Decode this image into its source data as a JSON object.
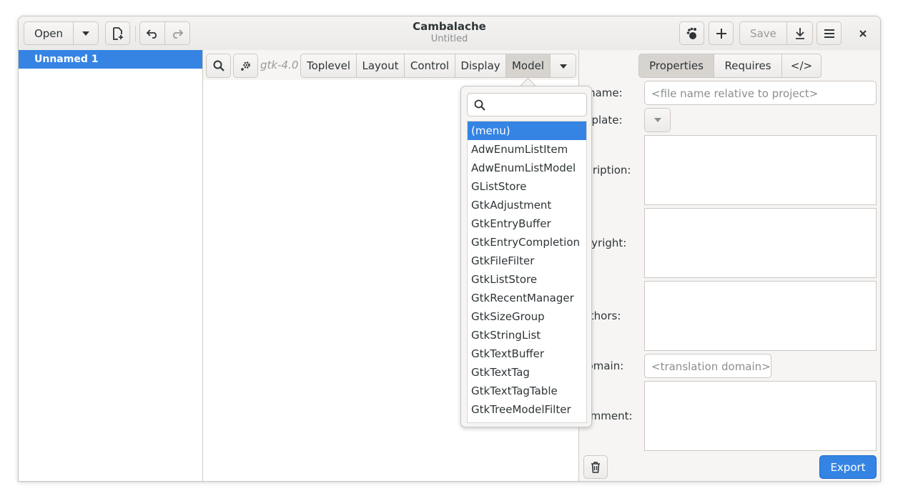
{
  "window": {
    "title": "Cambalache",
    "subtitle": "Untitled"
  },
  "headerbar": {
    "open_label": "Open",
    "save_label": "Save"
  },
  "project_tree": {
    "items": [
      {
        "label": "Unnamed 1",
        "selected": true
      }
    ]
  },
  "workspace_toolbar": {
    "gtk_version": "gtk-4.0",
    "categories": [
      {
        "label": "Toplevel"
      },
      {
        "label": "Layout"
      },
      {
        "label": "Control"
      },
      {
        "label": "Display"
      },
      {
        "label": "Model",
        "active": true
      }
    ]
  },
  "model_popover": {
    "search_placeholder": "",
    "items": [
      "(menu)",
      "AdwEnumListItem",
      "AdwEnumListModel",
      "GListStore",
      "GtkAdjustment",
      "GtkEntryBuffer",
      "GtkEntryCompletion",
      "GtkFileFilter",
      "GtkListStore",
      "GtkRecentManager",
      "GtkSizeGroup",
      "GtkStringList",
      "GtkTextBuffer",
      "GtkTextTag",
      "GtkTextTagTable",
      "GtkTreeModelFilter"
    ],
    "selected_item": "(menu)"
  },
  "properties_panel": {
    "tabs": [
      {
        "label": "Properties",
        "active": true
      },
      {
        "label": "Requires"
      },
      {
        "label": "</>"
      }
    ],
    "fields": {
      "filename_label": "Filename:",
      "filename_placeholder": "<file name relative to project>",
      "template_label": "Template:",
      "description_label": "Description:",
      "copyright_label": "Copyright:",
      "authors_label": "Authors:",
      "domain_label": "Domain:",
      "domain_placeholder": "<translation domain>",
      "comment_label": "Comment:"
    },
    "export_label": "Export"
  },
  "colors": {
    "accent": "#3584e4",
    "headerbar_bg": "#ebeae8",
    "pane_bg": "#f6f5f4"
  }
}
